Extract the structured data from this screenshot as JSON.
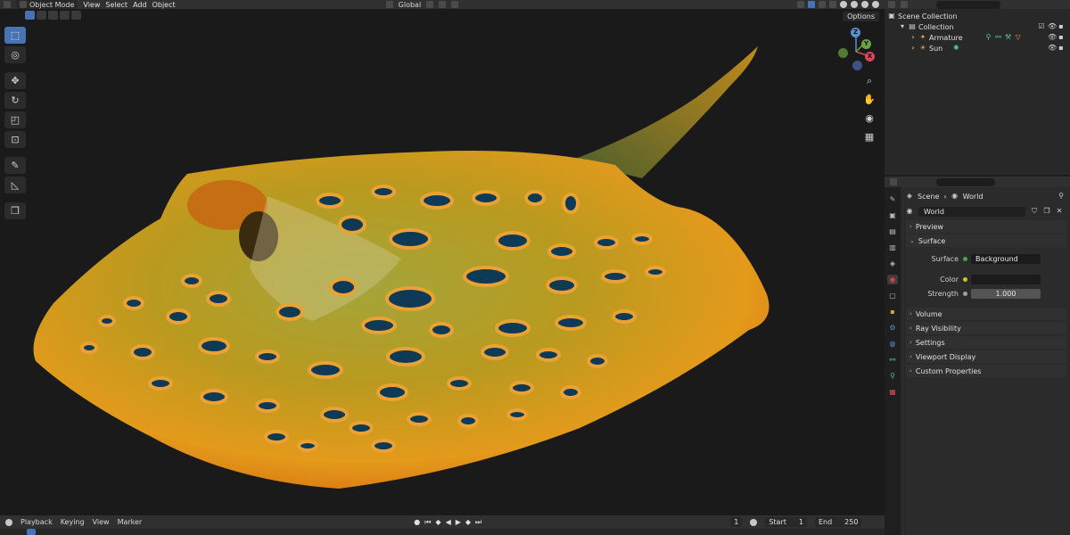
{
  "header": {
    "mode_label": "Object Mode",
    "menus": [
      "View",
      "Select",
      "Add",
      "Object"
    ],
    "transform_orientation": "Global"
  },
  "viewport": {
    "options_label": "Options",
    "accent_color": "#4772b3",
    "gizmo": {
      "z": "Z",
      "y": "Y",
      "x": "X"
    }
  },
  "outliner": {
    "scene_collection": "Scene Collection",
    "collection": "Collection",
    "objects": [
      "Armature",
      "Sun"
    ]
  },
  "properties": {
    "breadcrumb_scene": "Scene",
    "breadcrumb_world": "World",
    "world_name": "World",
    "panels_top": [
      "Preview",
      "Surface"
    ],
    "surface": {
      "surface_label": "Surface",
      "surface_value": "Background",
      "color_label": "Color",
      "strength_label": "Strength",
      "strength_value": "1.000"
    },
    "panels_bottom": [
      "Volume",
      "Ray Visibility",
      "Settings",
      "Viewport Display",
      "Custom Properties"
    ]
  },
  "timeline": {
    "menus": [
      "Playback",
      "Keying",
      "View",
      "Marker"
    ],
    "current_frame": "1",
    "start_label": "Start",
    "start_value": "1",
    "end_label": "End",
    "end_value": "250"
  }
}
